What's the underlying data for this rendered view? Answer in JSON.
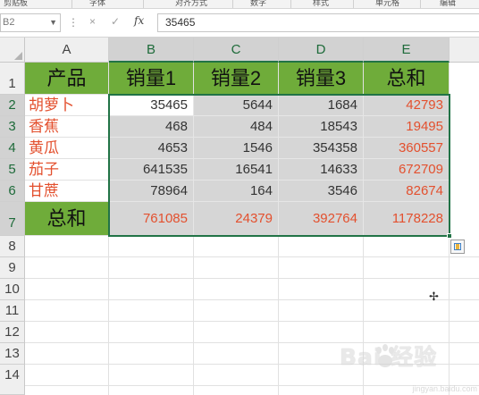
{
  "ribbon": {
    "groups": [
      "剪贴板",
      "字体",
      "对齐方式",
      "数字",
      "样式",
      "单元格",
      "编辑"
    ]
  },
  "formula_bar": {
    "name_box": "B2",
    "cancel_icon": "×",
    "enter_icon": "✓",
    "fx_label": "fx",
    "value": "35465"
  },
  "columns": [
    "A",
    "B",
    "C",
    "D",
    "E"
  ],
  "rows": [
    "1",
    "2",
    "3",
    "4",
    "5",
    "6",
    "7",
    "8",
    "9",
    "10",
    "11",
    "12",
    "13",
    "14"
  ],
  "table": {
    "headers": [
      "产品",
      "销量1",
      "销量2",
      "销量3",
      "总和"
    ],
    "products": [
      {
        "name": "胡萝卜",
        "s1": "35465",
        "s2": "5644",
        "s3": "1684",
        "total": "42793"
      },
      {
        "name": "香蕉",
        "s1": "468",
        "s2": "484",
        "s3": "18543",
        "total": "19495"
      },
      {
        "name": "黄瓜",
        "s1": "4653",
        "s2": "1546",
        "s3": "354358",
        "total": "360557"
      },
      {
        "name": "茄子",
        "s1": "641535",
        "s2": "16541",
        "s3": "14633",
        "total": "672709"
      },
      {
        "name": "甘蔗",
        "s1": "78964",
        "s2": "164",
        "s3": "3546",
        "total": "82674"
      }
    ],
    "total_row": {
      "label": "总和",
      "s1": "761085",
      "s2": "24379",
      "s3": "392764",
      "total": "1178228"
    }
  },
  "watermark": {
    "text": "Bai 经验",
    "sub": "jingyan.baidu.com"
  },
  "colors": {
    "header_green": "#6fac3a",
    "product_red": "#e3502e",
    "selection_green": "#217346",
    "selection_gray": "#d6d6d6"
  }
}
